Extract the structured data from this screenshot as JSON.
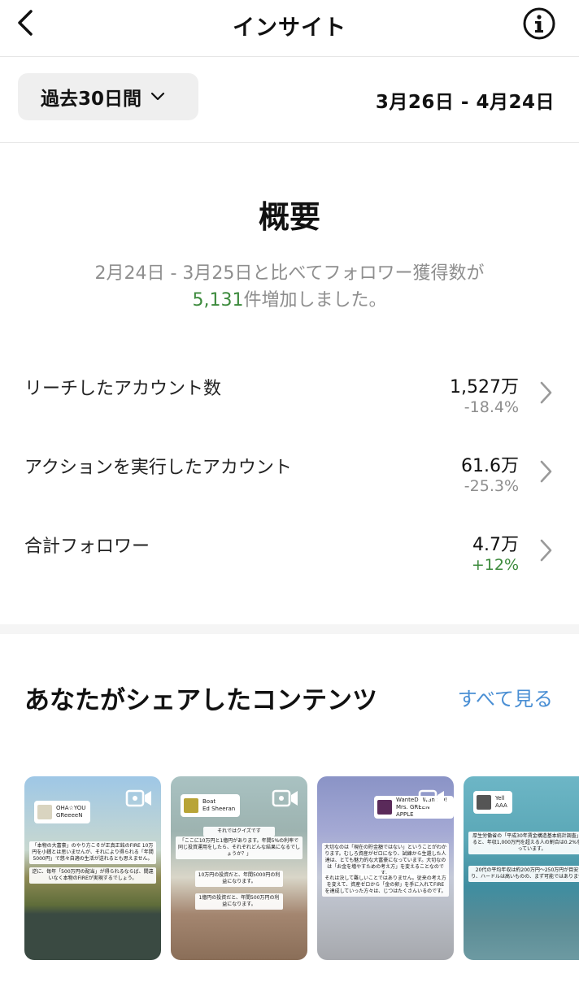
{
  "header": {
    "title": "インサイト",
    "back_icon": "chevron-left-icon",
    "info_icon": "info-icon"
  },
  "range": {
    "selected": "過去30日間",
    "dates": "3月26日 - 4月24日"
  },
  "overview": {
    "title": "概要",
    "compare_line1": "2月24日 - 3月25日と比べてフォロワー獲得数が",
    "compare_count": "5,131",
    "compare_suffix": "件増加しました。"
  },
  "metrics": [
    {
      "label": "リーチしたアカウント数",
      "value": "1,527万",
      "delta": "-18.4%"
    },
    {
      "label": "アクションを実行したアカウント",
      "value": "61.6万",
      "delta": "-25.3%"
    },
    {
      "label": "合計フォロワー",
      "value": "4.7万",
      "delta": "+12%"
    }
  ],
  "shared": {
    "title": "あなたがシェアしたコンテンツ",
    "see_all": "すべて見る",
    "items": [
      {
        "song": "OHA☆YOU",
        "artist": "GReeeeN",
        "caption1": "「本物の大富豪」のやり方こそが正真正銘のFIRE 10万円を小銭とは思いませんが、それにより得られる「年間5000円」で悠々自適の生活が送れるとも思えません。",
        "caption2": "逆に、毎年「500万円の配当」が得られるならば、間違いなく本物のFIREが実現するでしょう。"
      },
      {
        "song": "Boat",
        "artist": "Ed Sheeran",
        "caption1": "それではクイズです",
        "caption2": "「ここに10万円と1億円があります。年間5%の利率で同じ投資運用をしたら、それぞれどんな結果になるでしょうか？」",
        "caption3": "10万円の投資だと、年間5000円の利益になります。",
        "caption4": "1億円の投資だと、年間500万円の利益になります。"
      },
      {
        "song": "WanteD! WanteD!",
        "artist": "Mrs. GREEN APPLE",
        "caption1": "大切なのは「現在の貯金額ではない」ということがわかります。むしろ資産がゼロになり、試練から生還した人達は、とても魅力的な大富豪になっています。大切なのは「お金を増やすための考え方」を変えることなのです。",
        "caption2": "それは決して難しいことではありません。従来の考え方を変えて、資産ゼロから「金の卵」を手に入れてFIREを達成していった方々は、じつはたくさんいるのです。"
      },
      {
        "song": "Yell",
        "artist": "AAA",
        "caption1": "厚生労働省の「平成30年賃金構造基本統計調査」によると、年収1,000万円を超える人の割合は0.2%を下回っています。",
        "caption2": "20代の平均年収は約200万円〜250万円が目安であり、ハードルは高いものの、まず可能ではありません。"
      }
    ]
  }
}
